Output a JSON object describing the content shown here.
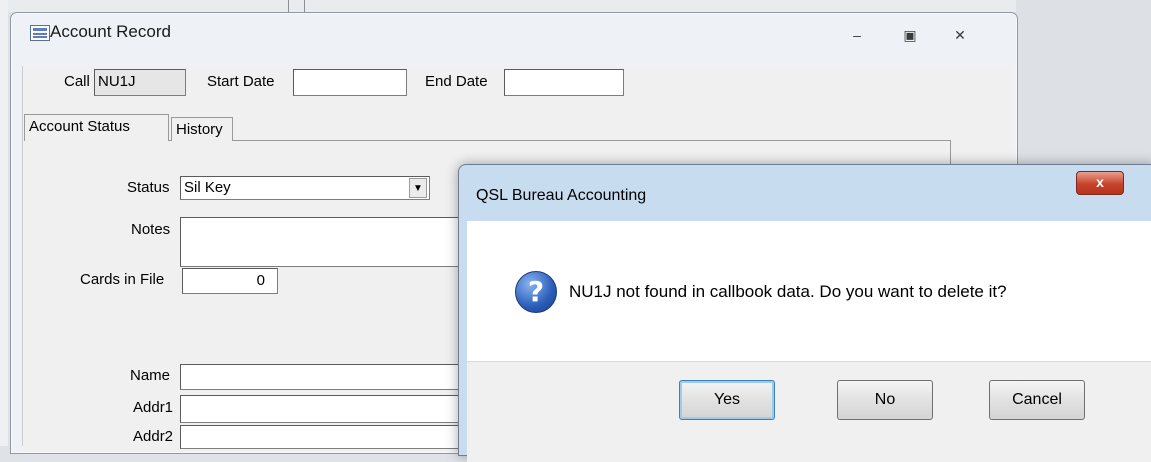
{
  "form_window": {
    "title": "Account Record",
    "call_label": "Call",
    "call_value": "NU1J",
    "start_date_label": "Start Date",
    "start_date_value": "",
    "end_date_label": "End Date",
    "end_date_value": "",
    "tabs": [
      {
        "label": "Account Status",
        "active": true
      },
      {
        "label": "History",
        "active": false
      }
    ],
    "status_label": "Status",
    "status_value": "Sil Key",
    "notes_label": "Notes",
    "notes_value": "",
    "cards_label": "Cards in File",
    "cards_value": "0",
    "name_label": "Name",
    "addr1_label": "Addr1",
    "addr2_label": "Addr2"
  },
  "dialog": {
    "title": "QSL Bureau Accounting",
    "close_glyph": "x",
    "message": "NU1J not found in callbook data.  Do you want to delete it?",
    "icon": "question-icon",
    "buttons": {
      "yes": "Yes",
      "no": "No",
      "cancel": "Cancel"
    }
  },
  "colors": {
    "dialog_frame": "#c8dcf0",
    "close_button": "#c6432c",
    "question_icon": "#2a5db9"
  }
}
